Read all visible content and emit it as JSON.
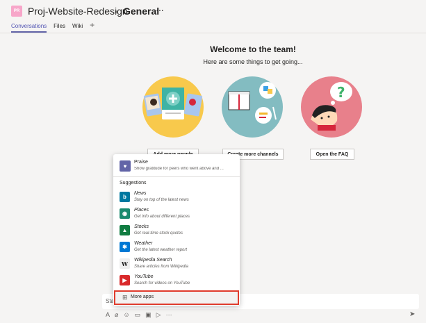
{
  "header": {
    "team_initials": "PR",
    "team_name": "Proj-Website-Redesign",
    "chevron": "›",
    "channel_name": "General",
    "more": "···",
    "tabs": [
      {
        "label": "Conversations",
        "active": true
      },
      {
        "label": "Files",
        "active": false
      },
      {
        "label": "Wiki",
        "active": false
      }
    ],
    "add_tab": "+"
  },
  "welcome": {
    "title": "Welcome to the team!",
    "subtitle": "Here are some things to get going..."
  },
  "actions": [
    {
      "label": "Add more people"
    },
    {
      "label": "Create more channels"
    },
    {
      "label": "Open the FAQ"
    }
  ],
  "popup": {
    "praise": {
      "title": "Praise",
      "desc": "Show gratitude for peers who went above and ...",
      "icon": "praise-icon"
    },
    "suggestions_label": "Suggestions",
    "apps": [
      {
        "name": "News",
        "desc": "Stay on top of the latest news",
        "color": "#0078a0",
        "icon": "b"
      },
      {
        "name": "Places",
        "desc": "Get info about different places",
        "color": "#1a8a6e",
        "icon": "◉"
      },
      {
        "name": "Stocks",
        "desc": "Get real-time stock quotes",
        "color": "#107c41",
        "icon": "▲"
      },
      {
        "name": "Weather",
        "desc": "Get the latest weather report",
        "color": "#0078d4",
        "icon": "✱"
      },
      {
        "name": "Wikipedia Search",
        "desc": "Share articles from Wikipedia",
        "color": "#eeeeee",
        "icon": "W"
      },
      {
        "name": "YouTube",
        "desc": "Search for videos on YouTube",
        "color": "#d9292b",
        "icon": "▶"
      }
    ],
    "more_apps": "More apps"
  },
  "compose": {
    "placeholder": "Sta"
  },
  "colors": {
    "accent": "#6264a7",
    "highlight": "#e03c2d"
  }
}
